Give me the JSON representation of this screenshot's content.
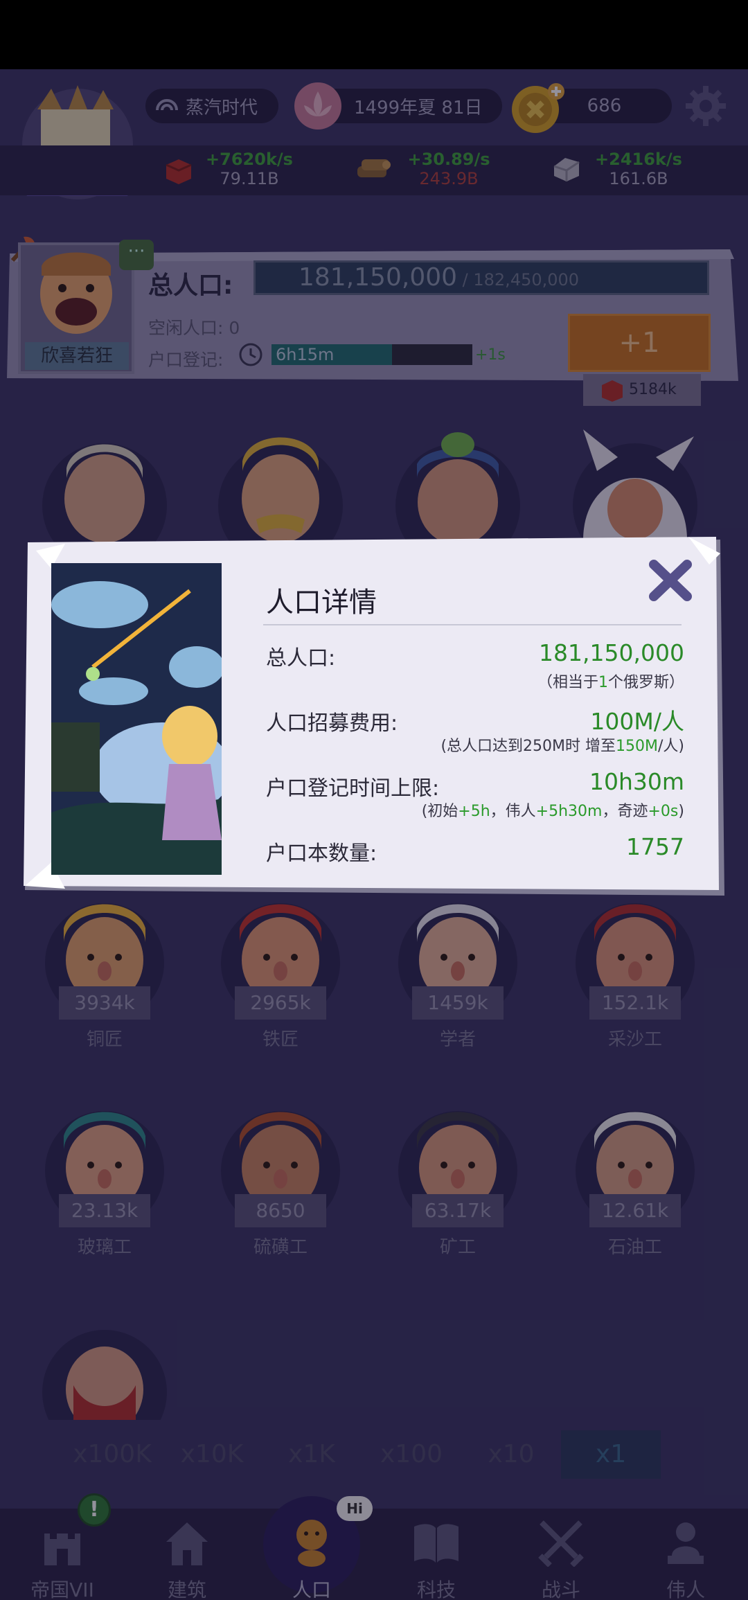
{
  "header": {
    "era": "蒸汽时代",
    "date": "1499年夏 81日",
    "coins": "686",
    "resources": [
      {
        "rate": "+7620k/s",
        "amount": "79.11B",
        "amount_red": false,
        "icon": "red-block-icon"
      },
      {
        "rate": "+30.89/s",
        "amount": "243.9B",
        "amount_red": true,
        "icon": "wood-icon"
      },
      {
        "rate": "+2416k/s",
        "amount": "161.6B",
        "amount_red": false,
        "icon": "stone-icon"
      }
    ]
  },
  "population": {
    "label": "总人口:",
    "current": "181,150,000",
    "max": " / 182,450,000",
    "mood": "欣喜若狂",
    "chat": "···",
    "idle": "空闲人口: 0",
    "register_label": "户口登记:",
    "register_time": "6h15m",
    "register_progress": 0.6,
    "register_plus": "+1s",
    "plus_button": "+1",
    "cost": "5184k"
  },
  "workers": [
    {
      "count": "3934k",
      "job": "铜匠"
    },
    {
      "count": "2965k",
      "job": "铁匠"
    },
    {
      "count": "1459k",
      "job": "学者"
    },
    {
      "count": "152.1k",
      "job": "采沙工"
    },
    {
      "count": "23.13k",
      "job": "玻璃工"
    },
    {
      "count": "8650",
      "job": "硫磺工"
    },
    {
      "count": "63.17k",
      "job": "矿工"
    },
    {
      "count": "12.61k",
      "job": "石油工"
    }
  ],
  "multipliers": [
    "x100K",
    "x10K",
    "x1K",
    "x100",
    "x10",
    "x1"
  ],
  "multiplier_active": "x1",
  "nav": [
    {
      "label": "帝国VII",
      "icon": "castle-icon"
    },
    {
      "label": "建筑",
      "icon": "house-icon"
    },
    {
      "label": "人口",
      "icon": "person-icon"
    },
    {
      "label": "科技",
      "icon": "book-icon"
    },
    {
      "label": "战斗",
      "icon": "swords-icon"
    },
    {
      "label": "伟人",
      "icon": "bust-icon"
    }
  ],
  "nav_alert": "!",
  "nav_hi": "Hi",
  "modal": {
    "title": "人口详情",
    "total_label": "总人口:",
    "total_value": "181,150,000",
    "total_note_pre": "（相当于",
    "total_note_num": "1",
    "total_note_post": "个俄罗斯）",
    "cost_label": "人口招募费用:",
    "cost_value": "100M/人",
    "cost_note_pre": "(总人口达到250M时 增至",
    "cost_note_num": "150M",
    "cost_note_post": "/人)",
    "limit_label": "户口登记时间上限:",
    "limit_value": "10h30m",
    "limit_note_a": "(初始",
    "limit_note_b": "+5h",
    "limit_note_c": "，伟人",
    "limit_note_d": "+5h30m",
    "limit_note_e": "，奇迹",
    "limit_note_f": "+0s",
    "limit_note_g": ")",
    "books_label": "户口本数量:",
    "books_value": "1757"
  }
}
